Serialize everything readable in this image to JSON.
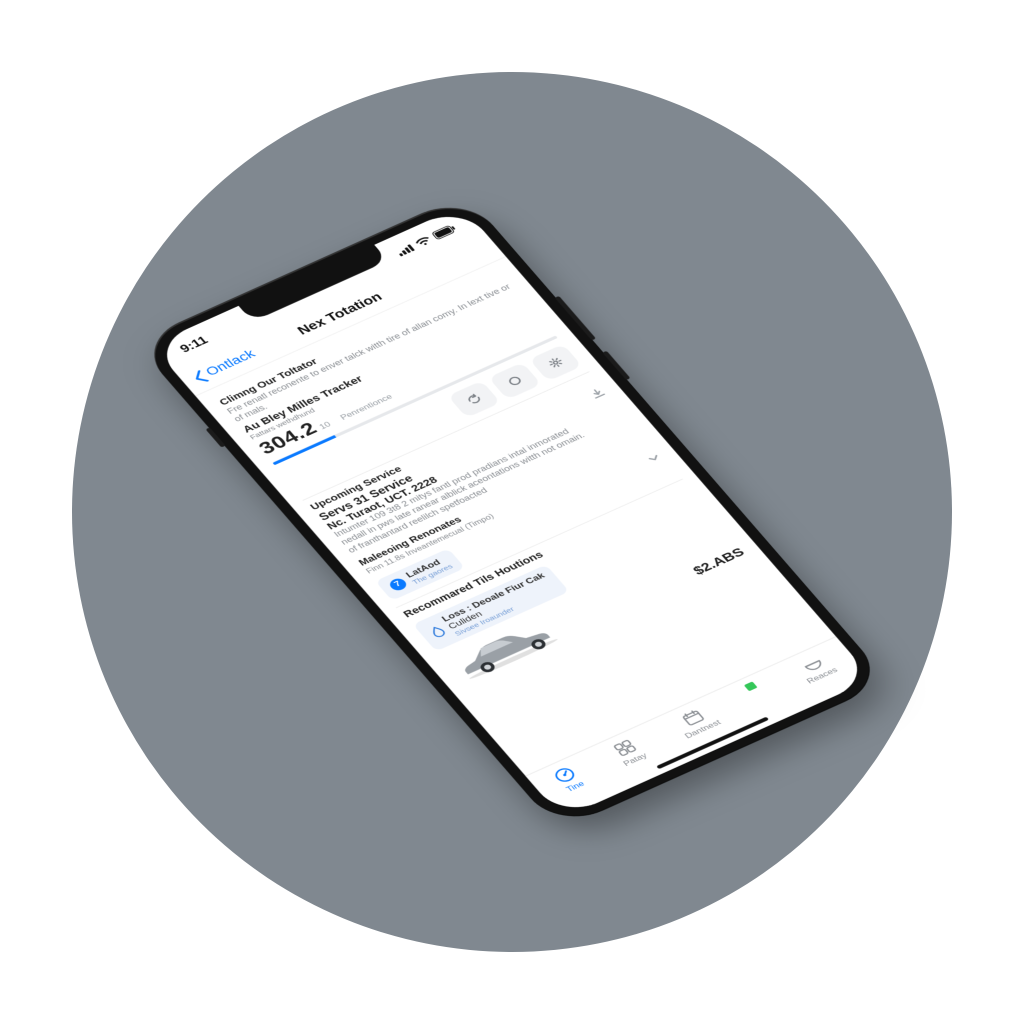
{
  "status": {
    "time": "9:11"
  },
  "nav": {
    "back_label": "Ontlack",
    "title": "Nex Totation"
  },
  "intro": {
    "eyebrow": "Climng Our Toltator",
    "body": "Fre renatl reconente to enver talck witth tire of allan comy. In lext tive or of mals."
  },
  "tracker": {
    "title": "Au Bley Milles Tracker",
    "subtitle": "Fattars wethdhund",
    "value": "304.2",
    "unit": "10",
    "label_right": "Penrentionce",
    "progress_pct": 22
  },
  "upcoming_header": "Upcoming Service",
  "service": {
    "title": "Servs 31 Service",
    "date": "Nc. Turaot, UCT. 2228",
    "body_1": "Intumter 109 3t8 2 mitys fantl prod pradians intal inmorated",
    "body_2": "nedall in pws late ranear alblick aceontations witth not omain.",
    "body_3": "of franthantard reelilch spetfoacted",
    "note_title": "Maleeoing Renonates",
    "note_sub": "Finn 11.8s Inveantemecual (Timpo)",
    "badge_count": "7",
    "badge_label": "LatAod",
    "badge_sub": "The gaores"
  },
  "recommend": {
    "header": "Recommared Tils Houtions",
    "pill_main": "Loss : Deoale Fiur Cak",
    "pill_line2": "Culiden",
    "pill_sub": "Sivsee Iroaunder",
    "price": "$2.ABS"
  },
  "tabs": {
    "tine": "Tine",
    "patay": "Patay",
    "dantnest": "Dantnest",
    "reaces": "Reaces"
  },
  "colors": {
    "accent": "#0a7aff",
    "muted": "#8b8f94",
    "chip_bg": "#eef3fb",
    "green": "#34c759"
  }
}
